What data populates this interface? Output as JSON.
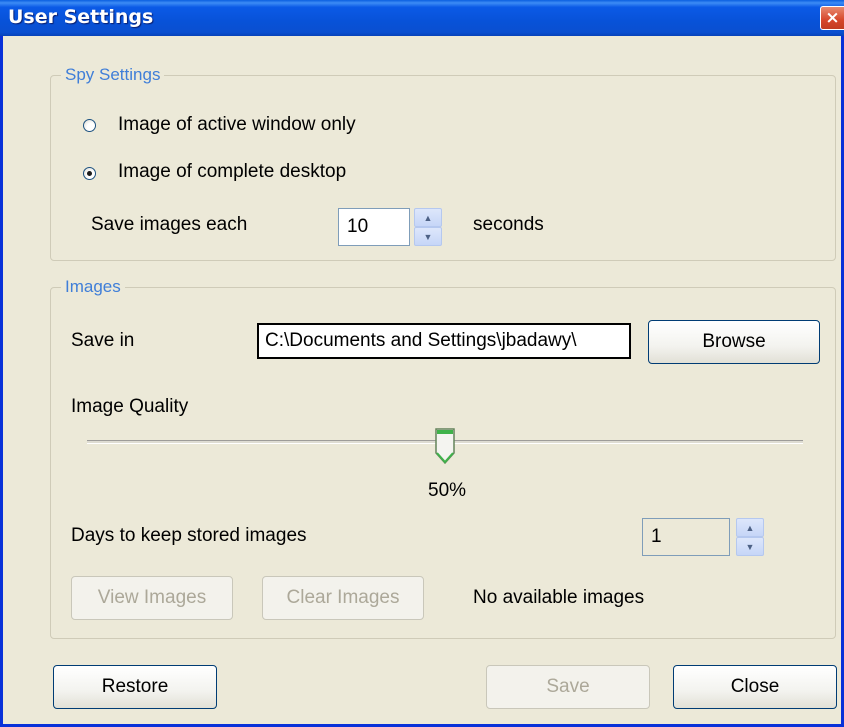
{
  "window": {
    "title": "User Settings",
    "close_glyph": "×"
  },
  "spy_settings": {
    "legend": "Spy Settings",
    "option_active_window": "Image of active window only",
    "option_complete_desktop": "Image of complete desktop",
    "selected_option": "Image of complete desktop",
    "save_each_label": "Save images each",
    "interval_value": "10",
    "interval_unit": "seconds"
  },
  "images": {
    "legend": "Images",
    "save_in_label": "Save in",
    "save_path": "C:\\Documents and Settings\\jbadawy\\",
    "browse_label": "Browse",
    "quality_label": "Image Quality",
    "quality_value": 0.5,
    "quality_text": "50%",
    "days_label": "Days to keep stored images",
    "days_value": "1",
    "view_images_label": "View Images",
    "clear_images_label": "Clear Images",
    "status_text": "No available images"
  },
  "footer": {
    "restore_label": "Restore",
    "save_label": "Save",
    "close_label": "Close"
  },
  "icons": {
    "close": "close-icon",
    "spin_up": "arrow-up-icon",
    "spin_down": "arrow-down-icon",
    "slider_thumb": "slider-thumb-icon"
  },
  "colors": {
    "window_bg": "#ece9d8",
    "titlebar": "#0852d8",
    "legend_text": "#3f7ed8",
    "disabled_text": "#aca899"
  }
}
